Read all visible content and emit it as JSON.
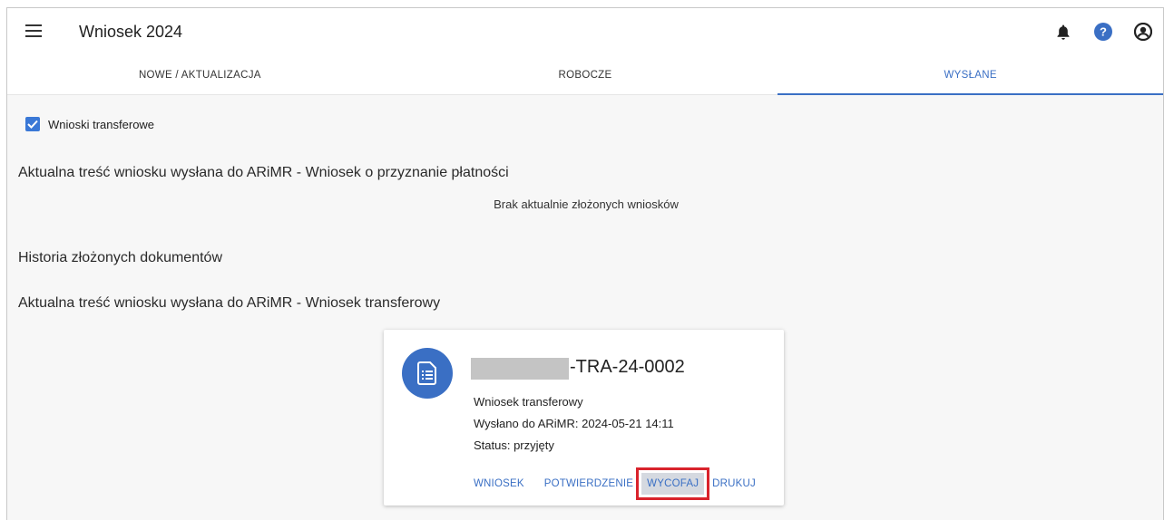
{
  "app": {
    "title": "Wniosek 2024"
  },
  "tabs": [
    {
      "label": "NOWE / AKTUALIZACJA",
      "active": false
    },
    {
      "label": "ROBOCZE",
      "active": false
    },
    {
      "label": "WYSŁANE",
      "active": true
    }
  ],
  "filters": {
    "transfer_checkbox_label": "Wnioski transferowe",
    "transfer_checked": true
  },
  "sections": {
    "payment_heading": "Aktualna treść wniosku wysłana do ARiMR - Wniosek o przyznanie płatności",
    "payment_empty": "Brak aktualnie złożonych wniosków",
    "history_heading": "Historia złożonych dokumentów",
    "transfer_heading": "Aktualna treść wniosku wysłana do ARiMR - Wniosek transferowy"
  },
  "card": {
    "id_suffix": "-TRA-24-0002",
    "type": "Wniosek transferowy",
    "sent": "Wysłano do ARiMR: 2024-05-21 14:11",
    "status": "Status: przyjęty",
    "actions": {
      "wniosek": "WNIOSEK",
      "potwierdzenie": "POTWIERDZENIE",
      "wycofaj": "WYCOFAJ",
      "drukuj": "DRUKUJ"
    },
    "icon": "document-list-icon"
  },
  "colors": {
    "accent": "#3a6fc4",
    "highlight": "#d9232c"
  }
}
